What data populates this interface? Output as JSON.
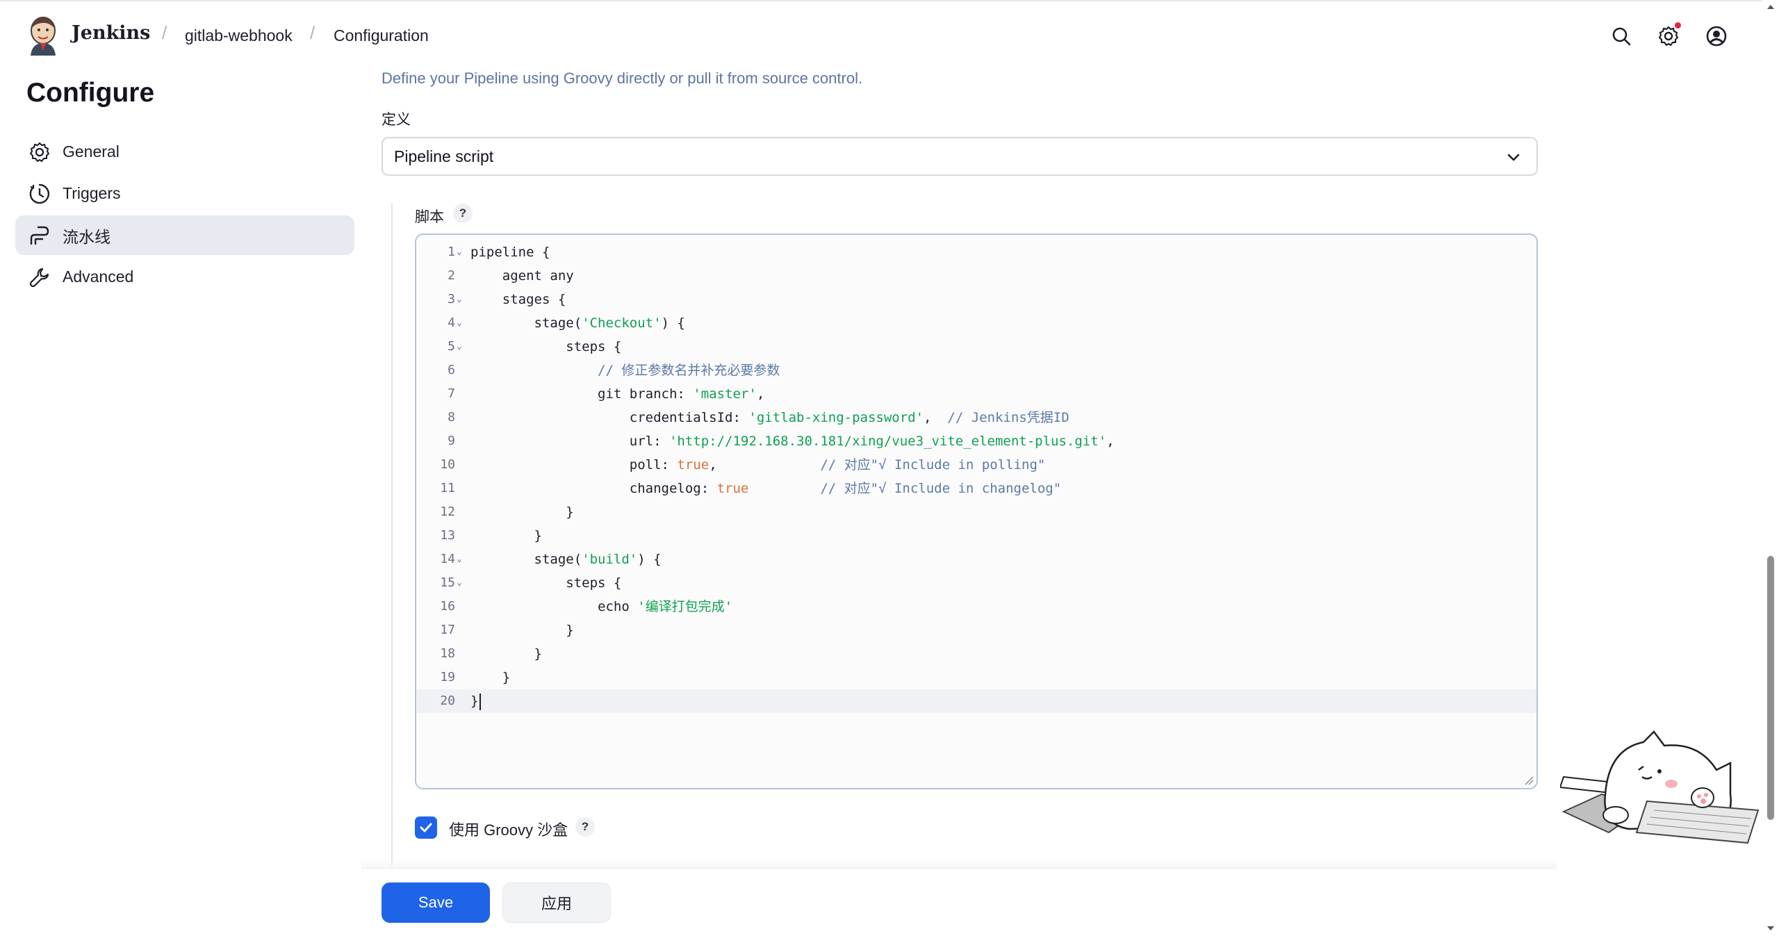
{
  "header": {
    "brand": "Jenkins",
    "breadcrumbs": [
      "gitlab-webhook",
      "Configuration"
    ],
    "icons": [
      "search-icon",
      "settings-icon",
      "user-icon"
    ],
    "notification_color": "#e5283b"
  },
  "sidebar": {
    "title": "Configure",
    "items": [
      {
        "label": "General",
        "icon": "gear-icon"
      },
      {
        "label": "Triggers",
        "icon": "clock-icon"
      },
      {
        "label": "流水线",
        "icon": "pipeline-icon",
        "active": true
      },
      {
        "label": "Advanced",
        "icon": "wrench-icon"
      }
    ]
  },
  "pipeline": {
    "description": "Define your Pipeline using Groovy directly or pull it from source control.",
    "definition_label": "定义",
    "definition_value": "Pipeline script",
    "script_label": "脚本",
    "help_glyph": "?",
    "sandbox_label": "使用 Groovy 沙盒",
    "sandbox_checked": true,
    "script_lines": [
      "pipeline {",
      "    agent any",
      "    stages {",
      "        stage('Checkout') {",
      "            steps {",
      "                // 修正参数名并补充必要参数",
      "                git branch: 'master',",
      "                    credentialsId: 'gitlab-xing-password',  // Jenkins凭据ID",
      "                    url: 'http://192.168.30.181/xing/vue3_vite_element-plus.git',",
      "                    poll: true,             // 对应\"√ Include in polling\"",
      "                    changelog: true         // 对应\"√ Include in changelog\"",
      "            }",
      "        }",
      "        stage('build') {",
      "            steps {",
      "                echo '编译打包完成'",
      "            }",
      "        }",
      "    }",
      "}"
    ]
  },
  "footer": {
    "save_label": "Save",
    "apply_label": "应用"
  },
  "colors": {
    "primary": "#1f63e8",
    "active_nav": "#e7eaf1",
    "string": "#10a052",
    "comment": "#5b7aa8",
    "boolean": "#d6733a"
  }
}
